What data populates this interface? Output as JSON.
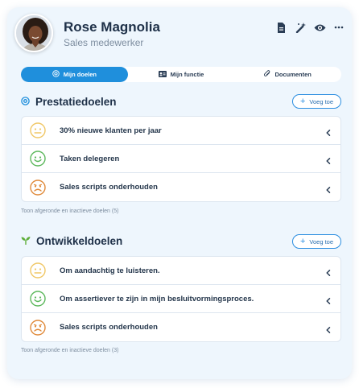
{
  "profile": {
    "name": "Rose Magnolia",
    "role": "Sales medewerker"
  },
  "header_icons": [
    "document-icon",
    "magic-wand-icon",
    "eye-icon",
    "more-icon"
  ],
  "tabs": [
    {
      "label": "Mijn doelen",
      "icon": "target-icon",
      "active": true
    },
    {
      "label": "Mijn functie",
      "icon": "id-card-icon",
      "active": false
    },
    {
      "label": "Documenten",
      "icon": "paperclip-icon",
      "active": false
    }
  ],
  "performance": {
    "title": "Prestatiedoelen",
    "add_label": "Voeg toe",
    "items": [
      {
        "label": "30% nieuwe klanten per jaar",
        "mood": "neutral"
      },
      {
        "label": "Taken delegeren",
        "mood": "happy"
      },
      {
        "label": "Sales scripts onderhouden",
        "mood": "sad"
      }
    ],
    "footnote": "Toon afgeronde en inactieve doelen (5)"
  },
  "development": {
    "title": "Ontwikkeldoelen",
    "add_label": "Voeg toe",
    "items": [
      {
        "label": "Om aandachtig te luisteren.",
        "mood": "neutral"
      },
      {
        "label": "Om assertiever te zijn in mijn besluitvormingsproces.",
        "mood": "happy"
      },
      {
        "label": "Sales scripts onderhouden",
        "mood": "sad"
      }
    ],
    "footnote": "Toon afgeronde en inactieve doelen (3)"
  },
  "colors": {
    "accent": "#1f8fdc",
    "neutral": "#f0c766",
    "happy": "#5cb85c",
    "sad": "#e08a3a",
    "leaf": "#5fae3a"
  }
}
